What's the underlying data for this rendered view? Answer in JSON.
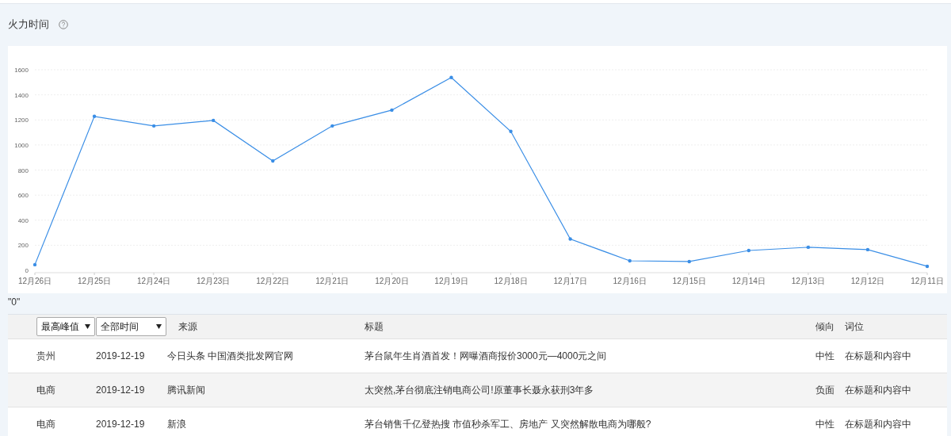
{
  "section_title": "火力时间",
  "chart": {
    "chart_data": {
      "type": "line",
      "categories": [
        "12月26日",
        "12月25日",
        "12月24日",
        "12月23日",
        "12月22日",
        "12月21日",
        "12月20日",
        "12月19日",
        "12月18日",
        "12月17日",
        "12月16日",
        "12月15日",
        "12月14日",
        "12月13日",
        "12月12日",
        "12月11日"
      ],
      "grid": true,
      "series": [
        {
          "color": "#3a8ee6",
          "values": [
            45,
            1228,
            1152,
            1196,
            873,
            1152,
            1278,
            1538,
            1108,
            250,
            76,
            70,
            158,
            184,
            165,
            32
          ]
        }
      ],
      "ylim": [
        0,
        1600
      ],
      "yticks": [
        0,
        200,
        400,
        600,
        800,
        1000,
        1200,
        1400,
        1600
      ]
    }
  },
  "value_label": "\"0\"",
  "table": {
    "header_selects": [
      "最高峰值",
      "全部时间"
    ],
    "columns": [
      "来源",
      "标题",
      "倾向",
      "词位"
    ],
    "rows": [
      {
        "region": "贵州",
        "date": "2019-12-19",
        "source": "今日头条 中国酒类批发网官网",
        "title": "茅台鼠年生肖酒首发！网曝酒商报价3000元—4000元之间",
        "tendency": "中性",
        "position": "在标题和内容中"
      },
      {
        "region": "电商",
        "date": "2019-12-19",
        "source": "腾讯新闻",
        "title": "太突然,茅台彻底注销电商公司!原董事长聂永获刑3年多",
        "tendency": "负面",
        "position": "在标题和内容中"
      },
      {
        "region": "电商",
        "date": "2019-12-19",
        "source": "新浪",
        "title": "茅台销售千亿登热搜 市值秒杀军工、房地产 又突然解散电商为哪般?",
        "tendency": "中性",
        "position": "在标题和内容中"
      }
    ]
  }
}
